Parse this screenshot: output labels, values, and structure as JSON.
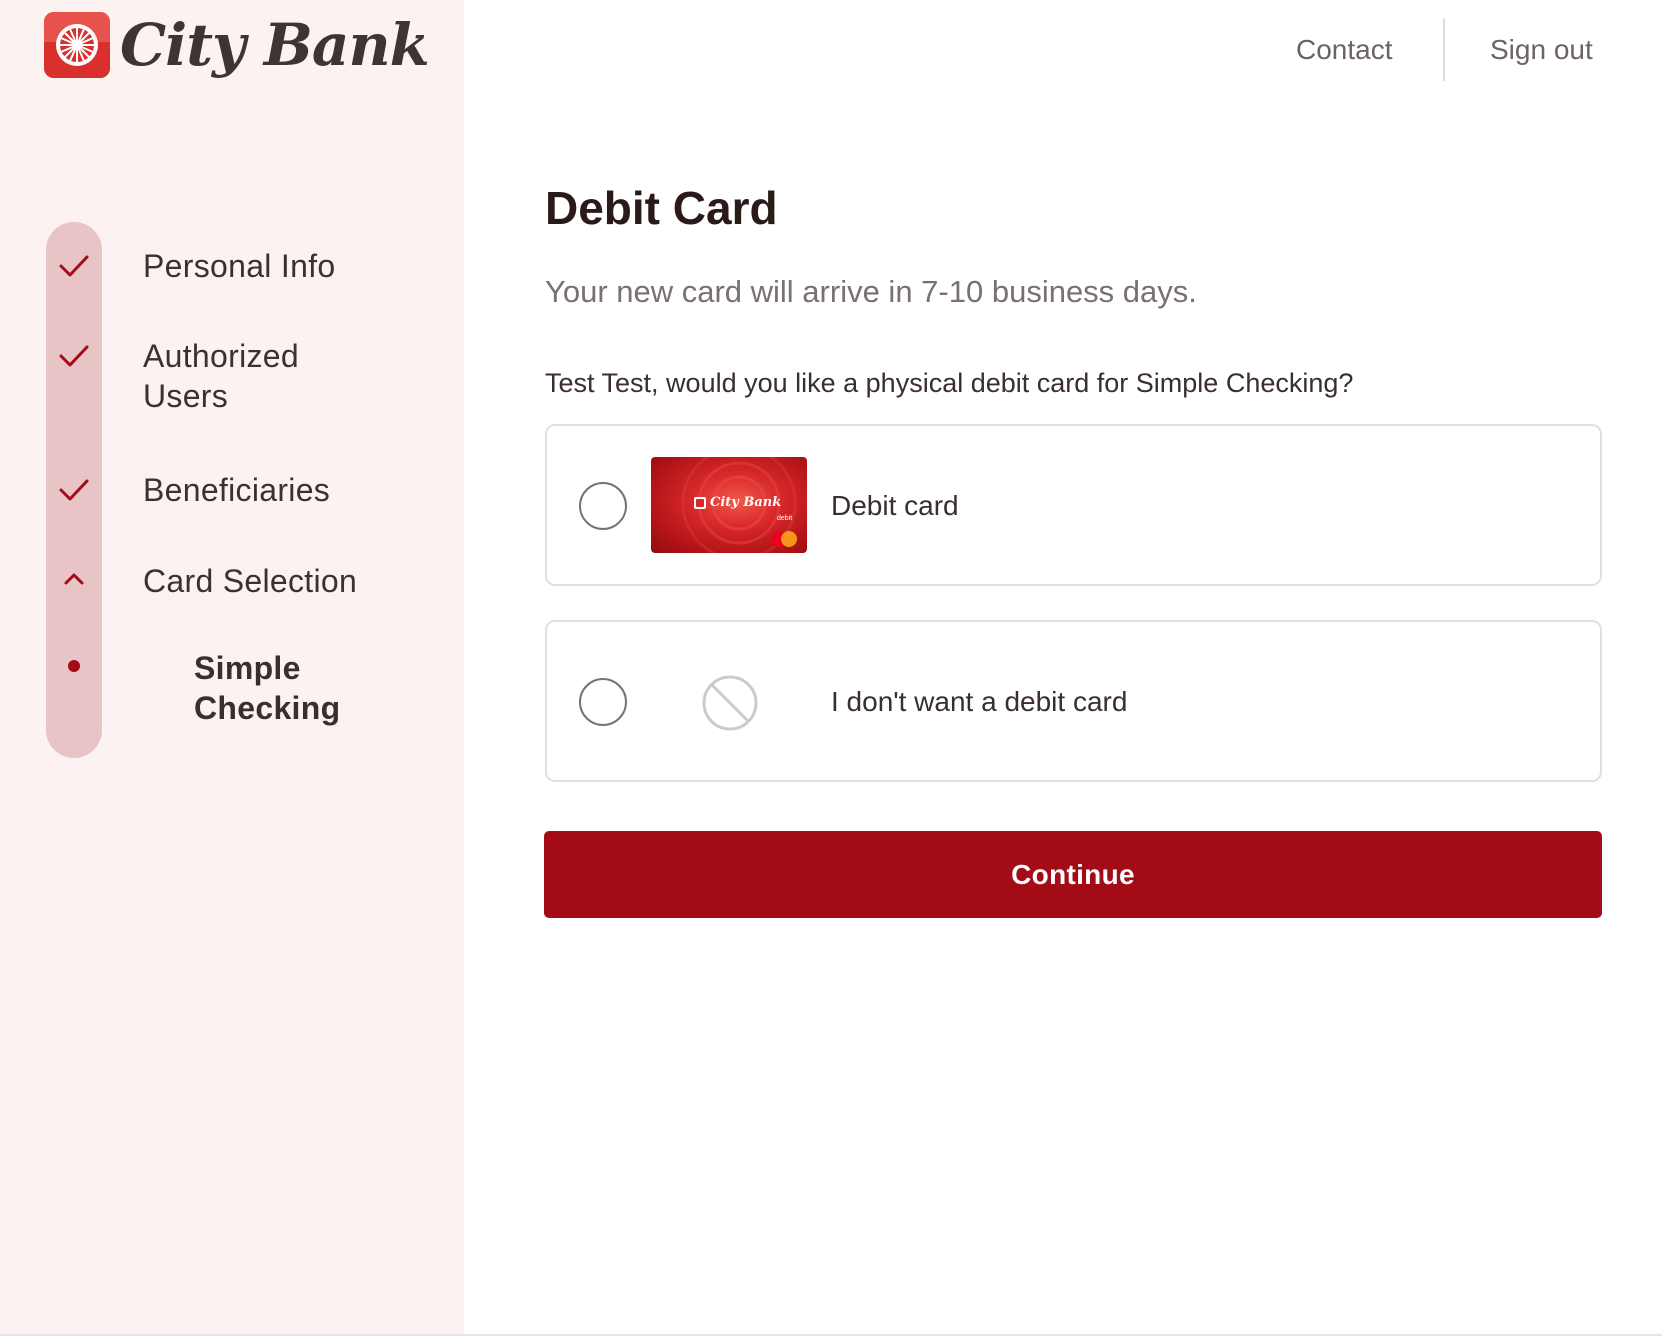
{
  "brand": {
    "name": "City Bank",
    "accent_color": "#a30c16",
    "logo_color": "#d42a2a"
  },
  "header": {
    "contact_label": "Contact",
    "signout_label": "Sign out"
  },
  "sidebar": {
    "steps": [
      {
        "label": "Personal Info",
        "icon": "checkmark-icon",
        "state": "complete"
      },
      {
        "label": "Authorized Users",
        "icon": "checkmark-icon",
        "state": "complete"
      },
      {
        "label": "Beneficiaries",
        "icon": "checkmark-icon",
        "state": "complete"
      },
      {
        "label": "Card Selection",
        "icon": "chevron-up-icon",
        "state": "current"
      },
      {
        "label": "Simple Checking",
        "icon": "dot-icon",
        "state": "current-substep"
      }
    ]
  },
  "main": {
    "title": "Debit Card",
    "subtitle": "Your new card will arrive in 7-10 business days.",
    "question": "Test Test, would you like a physical debit card for Simple Checking?",
    "options": [
      {
        "label": "Debit card",
        "icon": "debit-card-image",
        "selected": false,
        "card_brand_text": "City Bank",
        "card_type_text": "debit"
      },
      {
        "label": "I don't want a debit card",
        "icon": "no-symbol-icon",
        "selected": false
      }
    ],
    "continue_label": "Continue"
  }
}
